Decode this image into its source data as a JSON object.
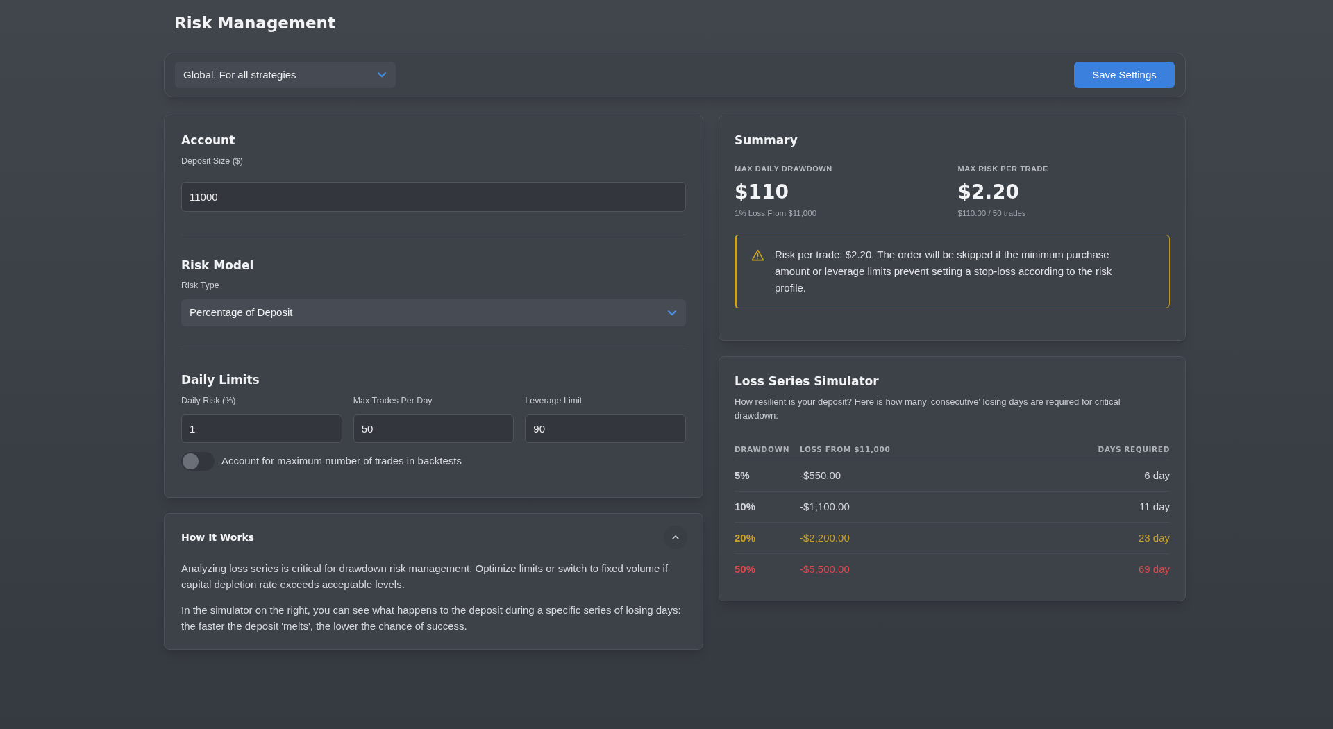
{
  "page": {
    "title": "Risk Management"
  },
  "toolbar": {
    "scope_select": {
      "value": "Global. For all strategies"
    },
    "save_button": "Save Settings"
  },
  "settings": {
    "account": {
      "title": "Account",
      "deposit": {
        "label": "Deposit Size ($)",
        "value": "11000"
      }
    },
    "risk_model": {
      "title": "Risk Model",
      "risk_type": {
        "label": "Risk Type",
        "value": "Percentage of Deposit"
      }
    },
    "daily_limits": {
      "title": "Daily Limits",
      "fields": [
        {
          "label": "Daily Risk (%)",
          "value": "1"
        },
        {
          "label": "Max Trades Per Day",
          "value": "50"
        },
        {
          "label": "Leverage Limit",
          "value": "90"
        }
      ],
      "toggle": {
        "label": "Account for maximum number of trades in backtests",
        "on": false
      }
    }
  },
  "how_it_works": {
    "title": "How It Works",
    "expanded": true,
    "paragraphs": [
      "Analyzing loss series is critical for drawdown risk management. Optimize limits or switch to fixed volume if capital depletion rate exceeds acceptable levels.",
      "In the simulator on the right, you can see what happens to the deposit during a specific series of losing days: the faster the deposit 'melts', the lower the chance of success."
    ]
  },
  "summary": {
    "title": "Summary",
    "metrics": [
      {
        "label": "MAX DAILY DRAWDOWN",
        "value": "$110",
        "note": "1% Loss From $11,000"
      },
      {
        "label": "MAX RISK PER TRADE",
        "value": "$2.20",
        "note": "$110.00 / 50 trades"
      }
    ],
    "warning": {
      "text": "Risk per trade: $2.20. The order will be skipped if the minimum purchase amount or leverage limits prevent setting a stop-loss according to the risk profile."
    }
  },
  "simulator": {
    "title": "Loss Series Simulator",
    "description": "How resilient is your deposit? Here is how many 'consecutive' losing days are required for critical drawdown:",
    "columns": [
      "DRAWDOWN",
      "LOSS FROM $11,000",
      "DAYS REQUIRED"
    ],
    "rows": [
      {
        "drawdown": "5%",
        "loss": "-$550.00",
        "days": "6 day",
        "color": "#d4d7db"
      },
      {
        "drawdown": "10%",
        "loss": "-$1,100.00",
        "days": "11 day",
        "color": "#d4d7db"
      },
      {
        "drawdown": "20%",
        "loss": "-$2,200.00",
        "days": "23 day",
        "color": "#c9a227"
      },
      {
        "drawdown": "50%",
        "loss": "-$5,500.00",
        "days": "69 day",
        "color": "#e0464e"
      }
    ]
  }
}
